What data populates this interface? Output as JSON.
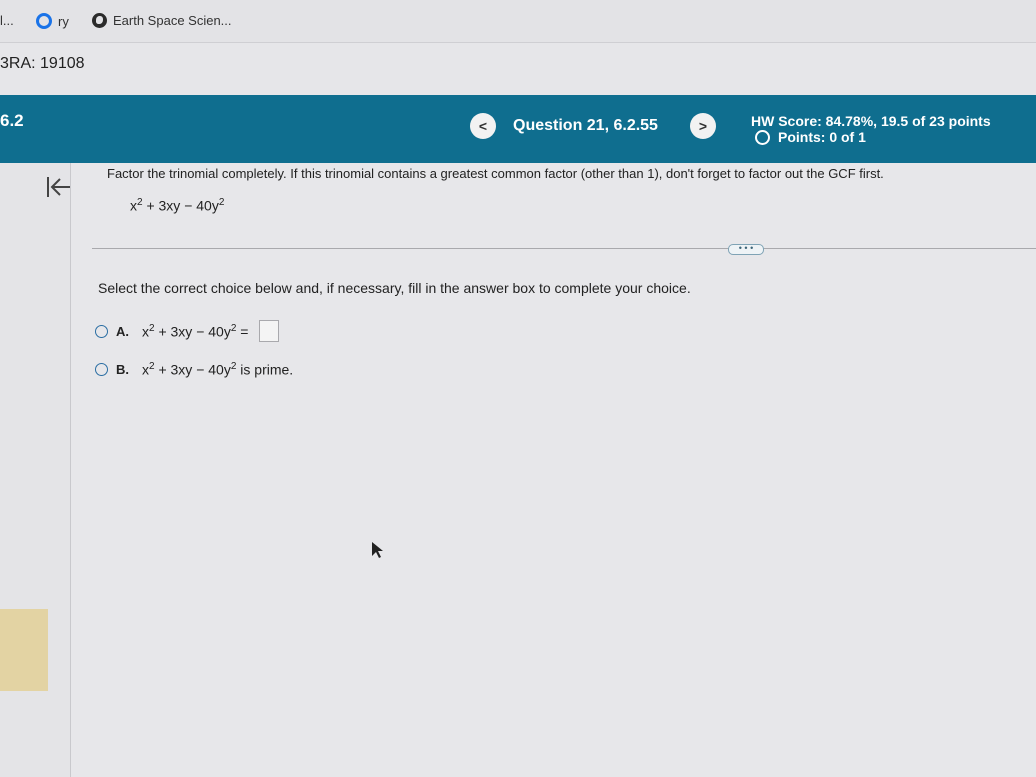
{
  "bookmarks": {
    "item1": "l...",
    "item2": "ry",
    "item3": "Earth Space Scien..."
  },
  "course": {
    "title": "3RA: 19108"
  },
  "header": {
    "section": "6.2",
    "prev_label": "<",
    "question_label": "Question 21, 6.2.55",
    "next_label": ">",
    "hw_score": "HW Score: 84.78%, 19.5 of 23 points",
    "points": "Points: 0 of 1"
  },
  "question": {
    "instruction": "Factor the trinomial completely. If this trinomial contains a greatest common factor (other than 1), don't forget to factor out the GCF first.",
    "expression": {
      "a": "x",
      "a_exp": "2",
      "b": " + 3xy − 40y",
      "b_exp": "2"
    },
    "more_label": "• • •",
    "select_prompt": "Select the correct choice below and, if necessary, fill in the answer box to complete your choice."
  },
  "choices": [
    {
      "letter": "A.",
      "suffix": " ="
    },
    {
      "letter": "B.",
      "suffix": " is prime."
    }
  ],
  "colors": {
    "header_bg": "#0f6e8f",
    "radio": "#2b6ea3"
  }
}
